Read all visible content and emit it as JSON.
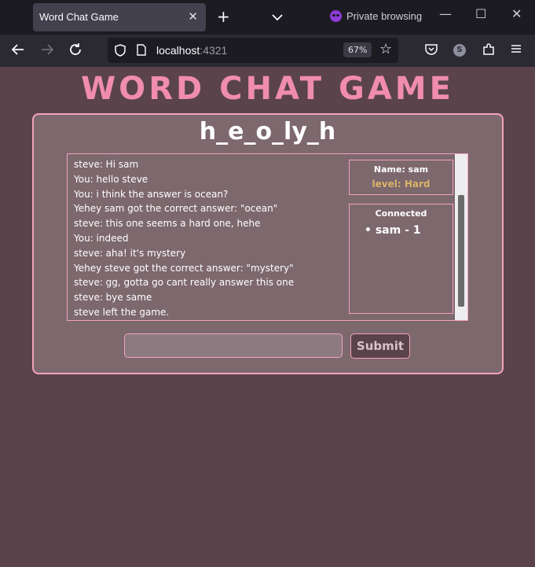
{
  "browser": {
    "tab_title": "Word Chat Game",
    "tab_close": "✕",
    "new_tab": "+",
    "private_label": "Private browsing",
    "url_host": "localhost",
    "url_port": ":4321",
    "zoom": "67%",
    "profile_initial": "S"
  },
  "game": {
    "title": "WORD CHAT GAME",
    "word": "h_e_o_ly_h"
  },
  "chat": {
    "messages": [
      "steve: Hi sam",
      "You: hello steve",
      "You: i think the answer is ocean?",
      "Yehey sam got the correct answer: \"ocean\"",
      "steve: this one seems a hard one, hehe",
      "You: indeed",
      "steve: aha! it's mystery",
      "Yehey steve got the correct answer: \"mystery\"",
      "steve: gg, gotta go cant really answer this one",
      "steve: bye same",
      "steve left the game."
    ]
  },
  "player": {
    "name_label": "Name: sam",
    "level_label": "level: Hard"
  },
  "connected": {
    "title": "Connected",
    "players": [
      "• sam - 1"
    ]
  },
  "form": {
    "input_value": "",
    "submit_label": "Submit"
  },
  "colors": {
    "accent": "#f08cad",
    "border": "#f4a2bc",
    "page_bg": "#5a434b",
    "panel_bg": "#7d686e",
    "level": "#d9b468"
  }
}
